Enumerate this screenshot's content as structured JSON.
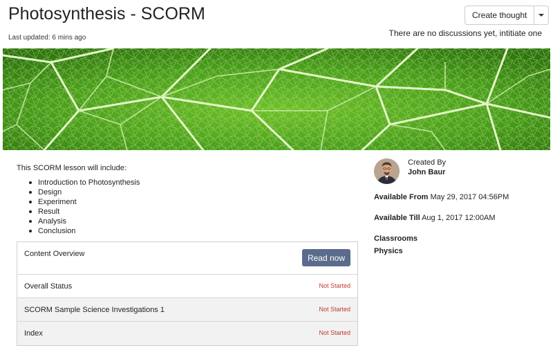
{
  "header": {
    "title": "Photosynthesis - SCORM",
    "last_updated": "Last updated: 6 mins ago",
    "create_thought_label": "Create thought",
    "discussions_text": "There are no discussions yet, intitiate one"
  },
  "lesson": {
    "intro": "This SCORM lesson will include:",
    "topics": [
      "Introduction to Photosynthesis",
      "Design",
      "Experiment",
      "Result",
      "Analysis",
      "Conclusion"
    ]
  },
  "content_overview": {
    "title": "Content Overview",
    "read_now_label": "Read now",
    "rows": [
      {
        "label": "Overall Status",
        "status": "Not Started"
      },
      {
        "label": "SCORM Sample Science Investigations 1",
        "status": "Not Started"
      },
      {
        "label": "Index",
        "status": "Not Started"
      }
    ]
  },
  "sidebar": {
    "created_by_label": "Created By",
    "creator_name": "John Baur",
    "available_from_label": "Available From",
    "available_from_value": "May 29, 2017 04:56PM",
    "available_till_label": "Available Till",
    "available_till_value": "Aug 1, 2017 12:00AM",
    "classrooms_label": "Classrooms",
    "classroom": "Physics"
  },
  "colors": {
    "banner_green": "#3f8f17",
    "button_bg": "#5b6b8c",
    "status_red": "#c0392b"
  }
}
